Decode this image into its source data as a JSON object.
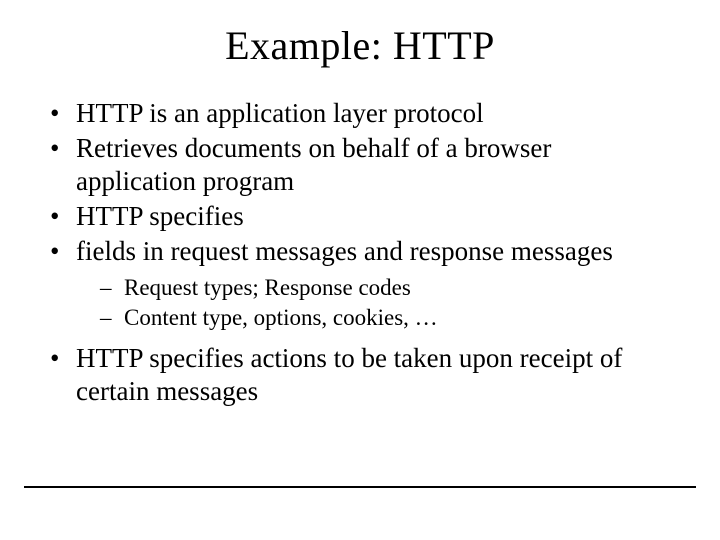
{
  "title": "Example:  HTTP",
  "bullets": {
    "b0": "HTTP is an application layer protocol",
    "b1": "Retrieves documents on behalf of a browser application program",
    "b2": "HTTP specifies",
    "b3": "fields in request messages and response messages",
    "b3_sub": {
      "s0": "Request types;  Response codes",
      "s1": "Content type, options, cookies, …"
    },
    "b4": "HTTP specifies actions to be taken upon receipt of certain messages"
  }
}
